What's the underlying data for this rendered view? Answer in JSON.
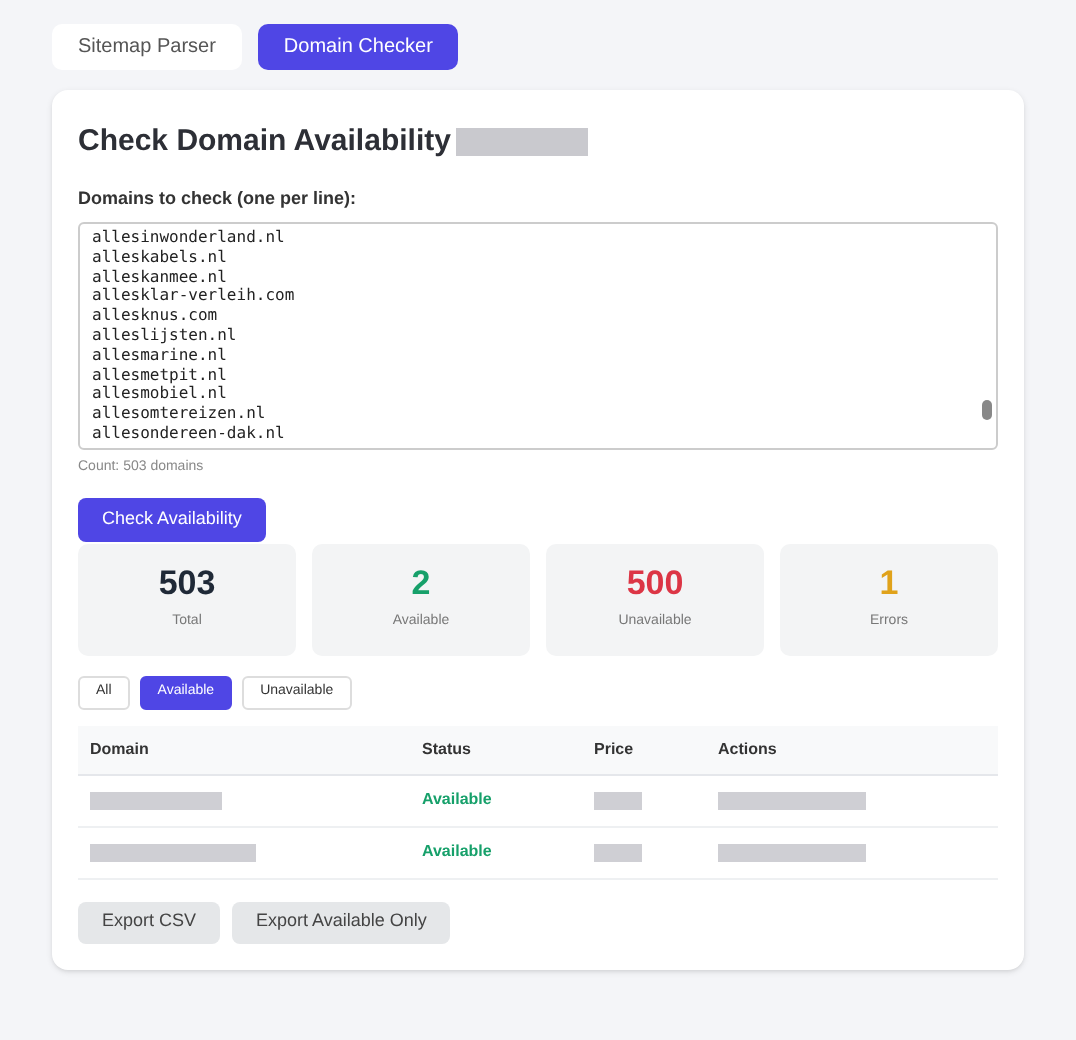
{
  "tabs": [
    {
      "label": "Sitemap Parser",
      "selected": false
    },
    {
      "label": "Domain Checker",
      "selected": true
    }
  ],
  "card": {
    "title": "Check Domain Availability",
    "field_label": "Domains to check (one per line):",
    "domains": [
      "allesinwonderland.nl",
      "alleskabels.nl",
      "alleskanmee.nl",
      "allesklar-verleih.com",
      "allesknus.com",
      "alleslijsten.nl",
      "allesmarine.nl",
      "allesmetpit.nl",
      "allesmobiel.nl",
      "allesomtereizen.nl",
      "allesondereen-dak.nl"
    ],
    "count": "Count: 503 domains",
    "check_button": "Check Availability"
  },
  "stats": [
    {
      "value": "503",
      "label": "Total",
      "color": "#1f2937"
    },
    {
      "value": "2",
      "label": "Available",
      "color": "#16a06a"
    },
    {
      "value": "500",
      "label": "Unavailable",
      "color": "#dc3545"
    },
    {
      "value": "1",
      "label": "Errors",
      "color": "#e0a21a"
    }
  ],
  "filters": [
    {
      "label": "All",
      "selected": false
    },
    {
      "label": "Available",
      "selected": true
    },
    {
      "label": "Unavailable",
      "selected": false
    }
  ],
  "table": {
    "columns": [
      "Domain",
      "Status",
      "Price",
      "Actions"
    ],
    "rows": [
      {
        "status": "Available"
      },
      {
        "status": "Available"
      }
    ]
  },
  "export_buttons": [
    "Export CSV",
    "Export Available Only"
  ]
}
